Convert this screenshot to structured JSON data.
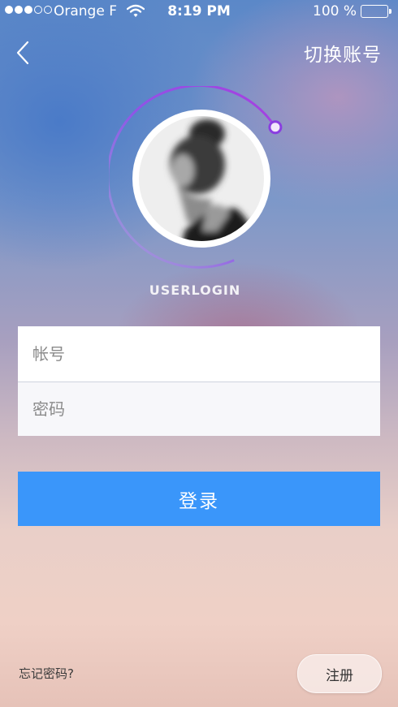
{
  "status_bar": {
    "carrier": "Orange F",
    "time": "8:19 PM",
    "battery": "100 %",
    "signal_bars_filled": 3,
    "signal_bars_total": 5
  },
  "nav": {
    "back_icon": "chevron-left-icon",
    "switch_account_label": "切换账号"
  },
  "profile": {
    "username": "USERLOGIN",
    "ring_color_start": "#7b5cf0",
    "ring_color_end": "#a83ee0"
  },
  "form": {
    "account_placeholder": "帐号",
    "password_placeholder": "密码"
  },
  "actions": {
    "login_label": "登录",
    "login_color": "#3a96fa",
    "forgot_label": "忘记密码?",
    "register_label": "注册"
  }
}
